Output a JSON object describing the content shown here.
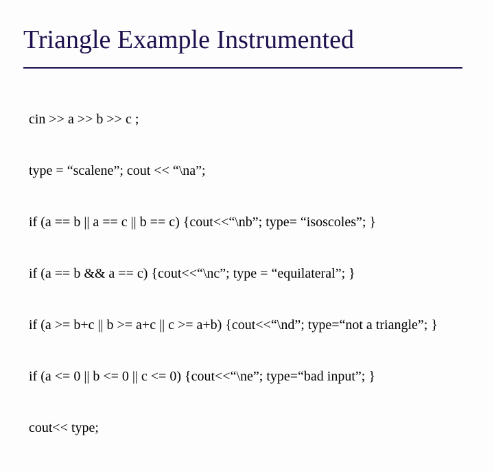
{
  "slide": {
    "title": "Triangle Example Instrumented",
    "code_lines": [
      "cin >> a >> b >> c ;",
      "type = “scalene”; cout << “\\na”;",
      "if (a == b || a == c || b == c) {cout<<“\\nb”; type= “isoscoles”; }",
      "if (a == b && a == c) {cout<<“\\nc”; type = “equilateral”; }",
      "if (a >= b+c || b >= a+c || c >= a+b) {cout<<“\\nd”; type=“not a triangle”; }",
      "if (a <= 0 || b <= 0 || c <= 0) {cout<<“\\ne”; type=“bad input”; }",
      "cout<< type;"
    ]
  }
}
